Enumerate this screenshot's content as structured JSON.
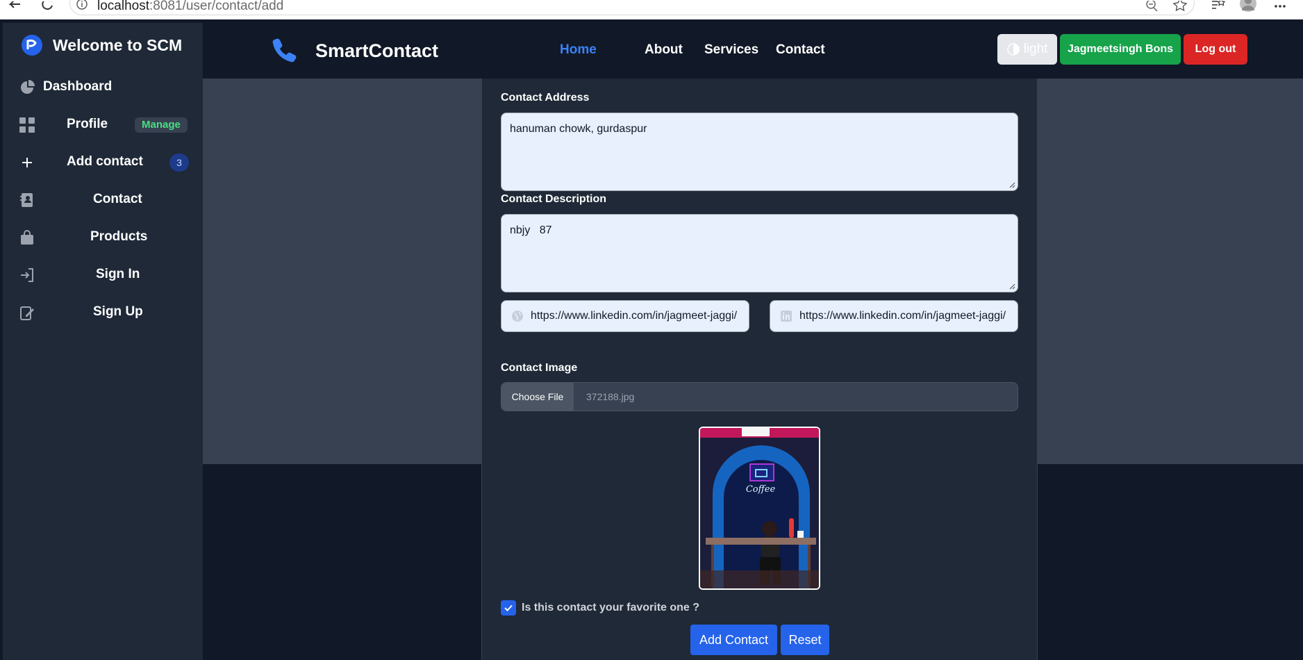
{
  "browser": {
    "url_host": "localhost",
    "url_rest": ":8081/user/contact/add"
  },
  "sidebar": {
    "brand_title": "Welcome to SCM",
    "items": [
      {
        "label": "Dashboard",
        "icon": "chart-pie-icon"
      },
      {
        "label": "Profile",
        "icon": "grid-icon",
        "badge": "Manage"
      },
      {
        "label": "Add contact",
        "icon": "plus-icon",
        "badge": "3"
      },
      {
        "label": "Contact",
        "icon": "address-book-icon"
      },
      {
        "label": "Products",
        "icon": "shopping-bag-icon"
      },
      {
        "label": "Sign In",
        "icon": "sign-in-icon"
      },
      {
        "label": "Sign Up",
        "icon": "sign-up-icon"
      }
    ]
  },
  "navbar": {
    "logo_text": "SmartContact",
    "links": [
      "Home",
      "About",
      "Services",
      "Contact"
    ],
    "active_link": "Home",
    "theme_label": "light",
    "user_label": "Jagmeetsingh Bons",
    "logout_label": "Log out"
  },
  "form": {
    "address_label": "Contact Address",
    "address_value": "hanuman chowk, gurdaspur",
    "description_label": "Contact Description",
    "description_value": "nbjy   87",
    "website_value": "https://www.linkedin.com/in/jagmeet-jaggi/",
    "linkedin_value": "https://www.linkedin.com/in/jagmeet-jaggi/",
    "image_label": "Contact Image",
    "choose_file_label": "Choose File",
    "file_name": "372188.jpg",
    "favorite_label": "Is this contact your favorite one ?",
    "favorite_checked": true,
    "add_button": "Add Contact",
    "reset_button": "Reset"
  },
  "colors": {
    "sidebar_bg": "#1f2937",
    "nav_bg": "#111827",
    "accent_blue": "#2563eb",
    "active_link": "#3b82f6",
    "user_button": "#16a34a",
    "logout_button": "#dc2626"
  }
}
